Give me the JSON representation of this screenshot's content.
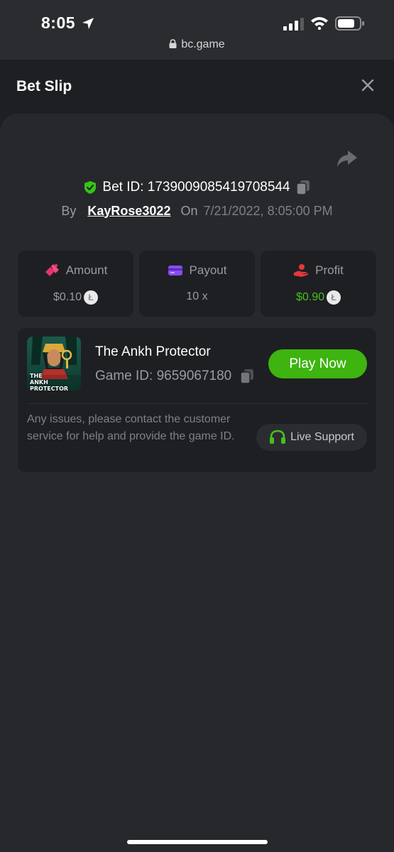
{
  "status_bar": {
    "time": "8:05",
    "url": "bc.game"
  },
  "header": {
    "title": "Bet Slip"
  },
  "bet": {
    "id_text": "Bet ID: 1739009085419708544",
    "by_label": "By",
    "username": "KayRose3022",
    "on_label": "On",
    "datetime": "7/21/2022, 8:05:00 PM"
  },
  "stats": {
    "amount_label": "Amount",
    "amount_value": "$0.10",
    "payout_label": "Payout",
    "payout_value": "10 x",
    "profit_label": "Profit",
    "profit_value": "$0.90"
  },
  "game": {
    "title": "The Ankh Protector",
    "id_text": "Game ID: 9659067180",
    "thumb_caption": "THE ANKH PROTECTOR",
    "play_label": "Play Now",
    "issues_text": "Any issues, please contact the customer service for help and provide the game ID.",
    "support_label": "Live Support"
  },
  "colors": {
    "accent_green": "#3db40f",
    "profit_green": "#46c11a",
    "shield_green": "#35c515",
    "amount_pink": "#e8336b",
    "payout_purple": "#8a4cf0",
    "profit_red": "#e5373b"
  },
  "icons": [
    "location-arrow-icon",
    "signal-icon",
    "wifi-icon",
    "battery-icon",
    "lock-icon",
    "close-icon",
    "share-icon",
    "shield-check-icon",
    "copy-icon",
    "amount-icon",
    "payout-card-icon",
    "profit-hand-icon",
    "coin-icon",
    "headset-icon"
  ]
}
